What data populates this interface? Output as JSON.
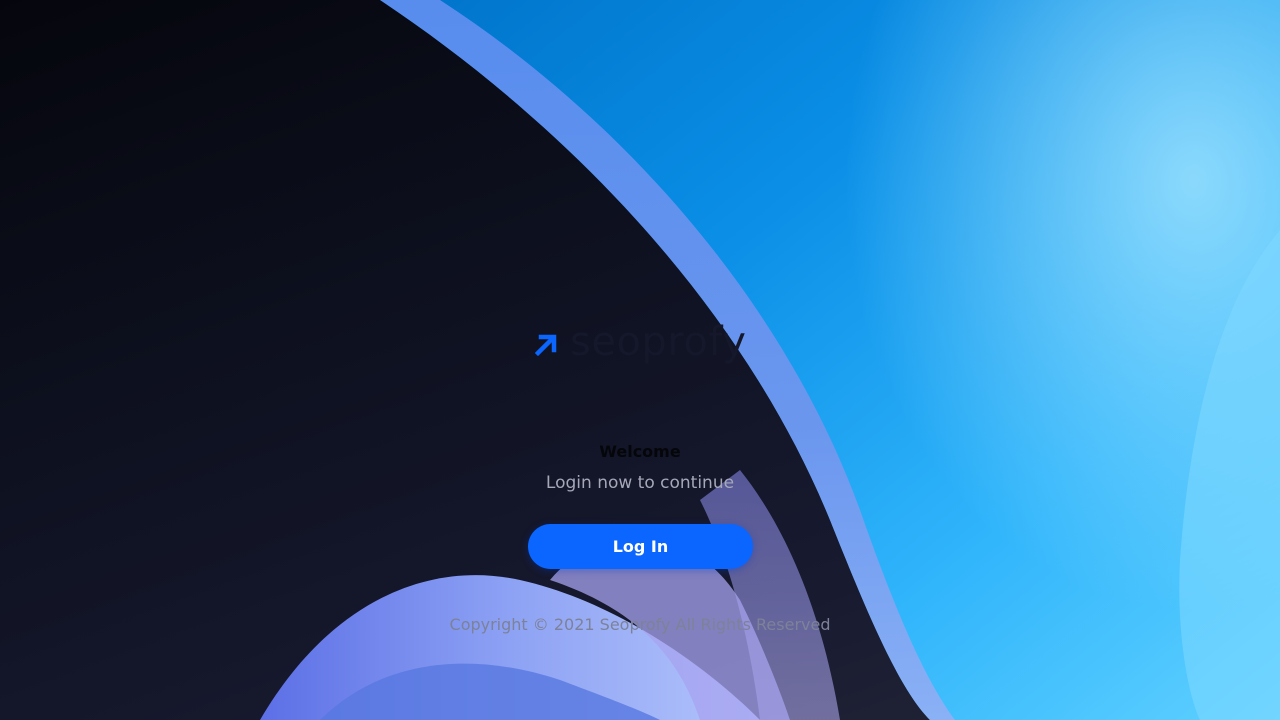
{
  "brand": {
    "name": "seoprofy",
    "logo_icon": "arrow-up-right-icon",
    "accent_color": "#0a66ff"
  },
  "welcome": {
    "title": "Welcome",
    "subtitle": "Login now to continue"
  },
  "actions": {
    "login_label": "Log In"
  },
  "footer": {
    "copyright": "Copyright © 2021 Seoprofy All Rights Reserved"
  },
  "colors": {
    "button": "#0a66ff",
    "background_dark": "#0e1120",
    "background_wave": "#2a9bf0"
  }
}
